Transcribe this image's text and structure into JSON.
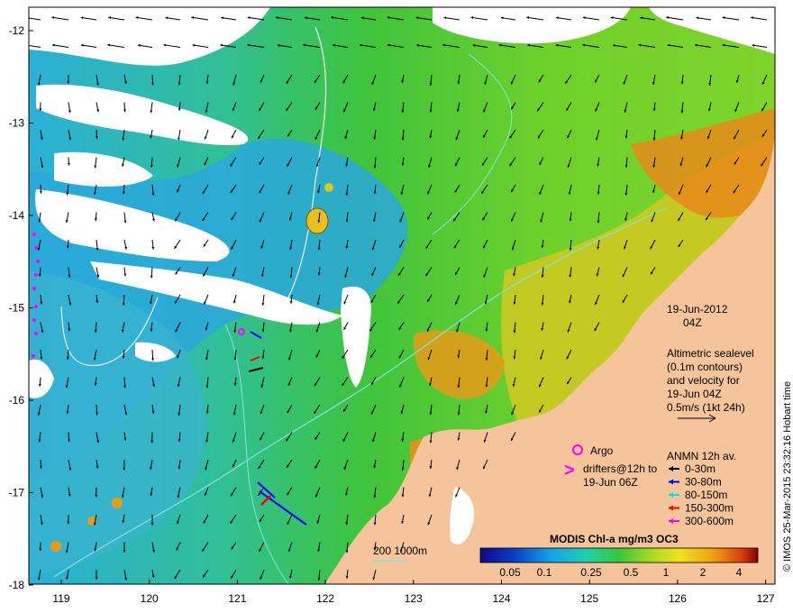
{
  "map": {
    "date": "19-Jun-2012",
    "time": "04Z",
    "altimetry": {
      "line1": "Altimetric sealevel",
      "line2": "(0.1m contours)",
      "line3": "and velocity for",
      "line4": "19-Jun 04Z",
      "line5": "0.5m/s (1kt 24h)"
    },
    "argo_label": "Argo",
    "drifters": {
      "line1": "drifters@12h to",
      "line2": "19-Jun 06Z"
    },
    "anmn": {
      "title": "ANMN 12h av.",
      "items": [
        {
          "label": "0-30m",
          "color": "#000000"
        },
        {
          "label": "30-80m",
          "color": "#0000ff"
        },
        {
          "label": "80-150m",
          "color": "#00e0e0"
        },
        {
          "label": "150-300m",
          "color": "#ff0000"
        },
        {
          "label": "300-600m",
          "color": "#ff00ff"
        }
      ]
    },
    "isobath_label": "200  1000m",
    "colorbar": {
      "title": "MODIS Chl-a mg/m3 OC3",
      "ticks": [
        "0.05",
        "0.1",
        "0.25",
        "0.5",
        "1",
        "2",
        "4"
      ]
    },
    "credit": "© IMOS 25-Mar-2015 23:32:16 Hobart time",
    "lon_ticks": [
      "119",
      "120",
      "121",
      "122",
      "123",
      "124",
      "125",
      "126",
      "127"
    ],
    "lat_ticks": [
      "-12",
      "-13",
      "-14",
      "-15",
      "-16",
      "-17",
      "-18"
    ],
    "colors": {
      "land": "#f5c49a",
      "cloud": "#ffffff",
      "ocean_low": "#2aa8e0",
      "ocean_mid": "#39c24a",
      "ocean_high": "#e08a14",
      "contour": "#7fe6e0"
    }
  }
}
